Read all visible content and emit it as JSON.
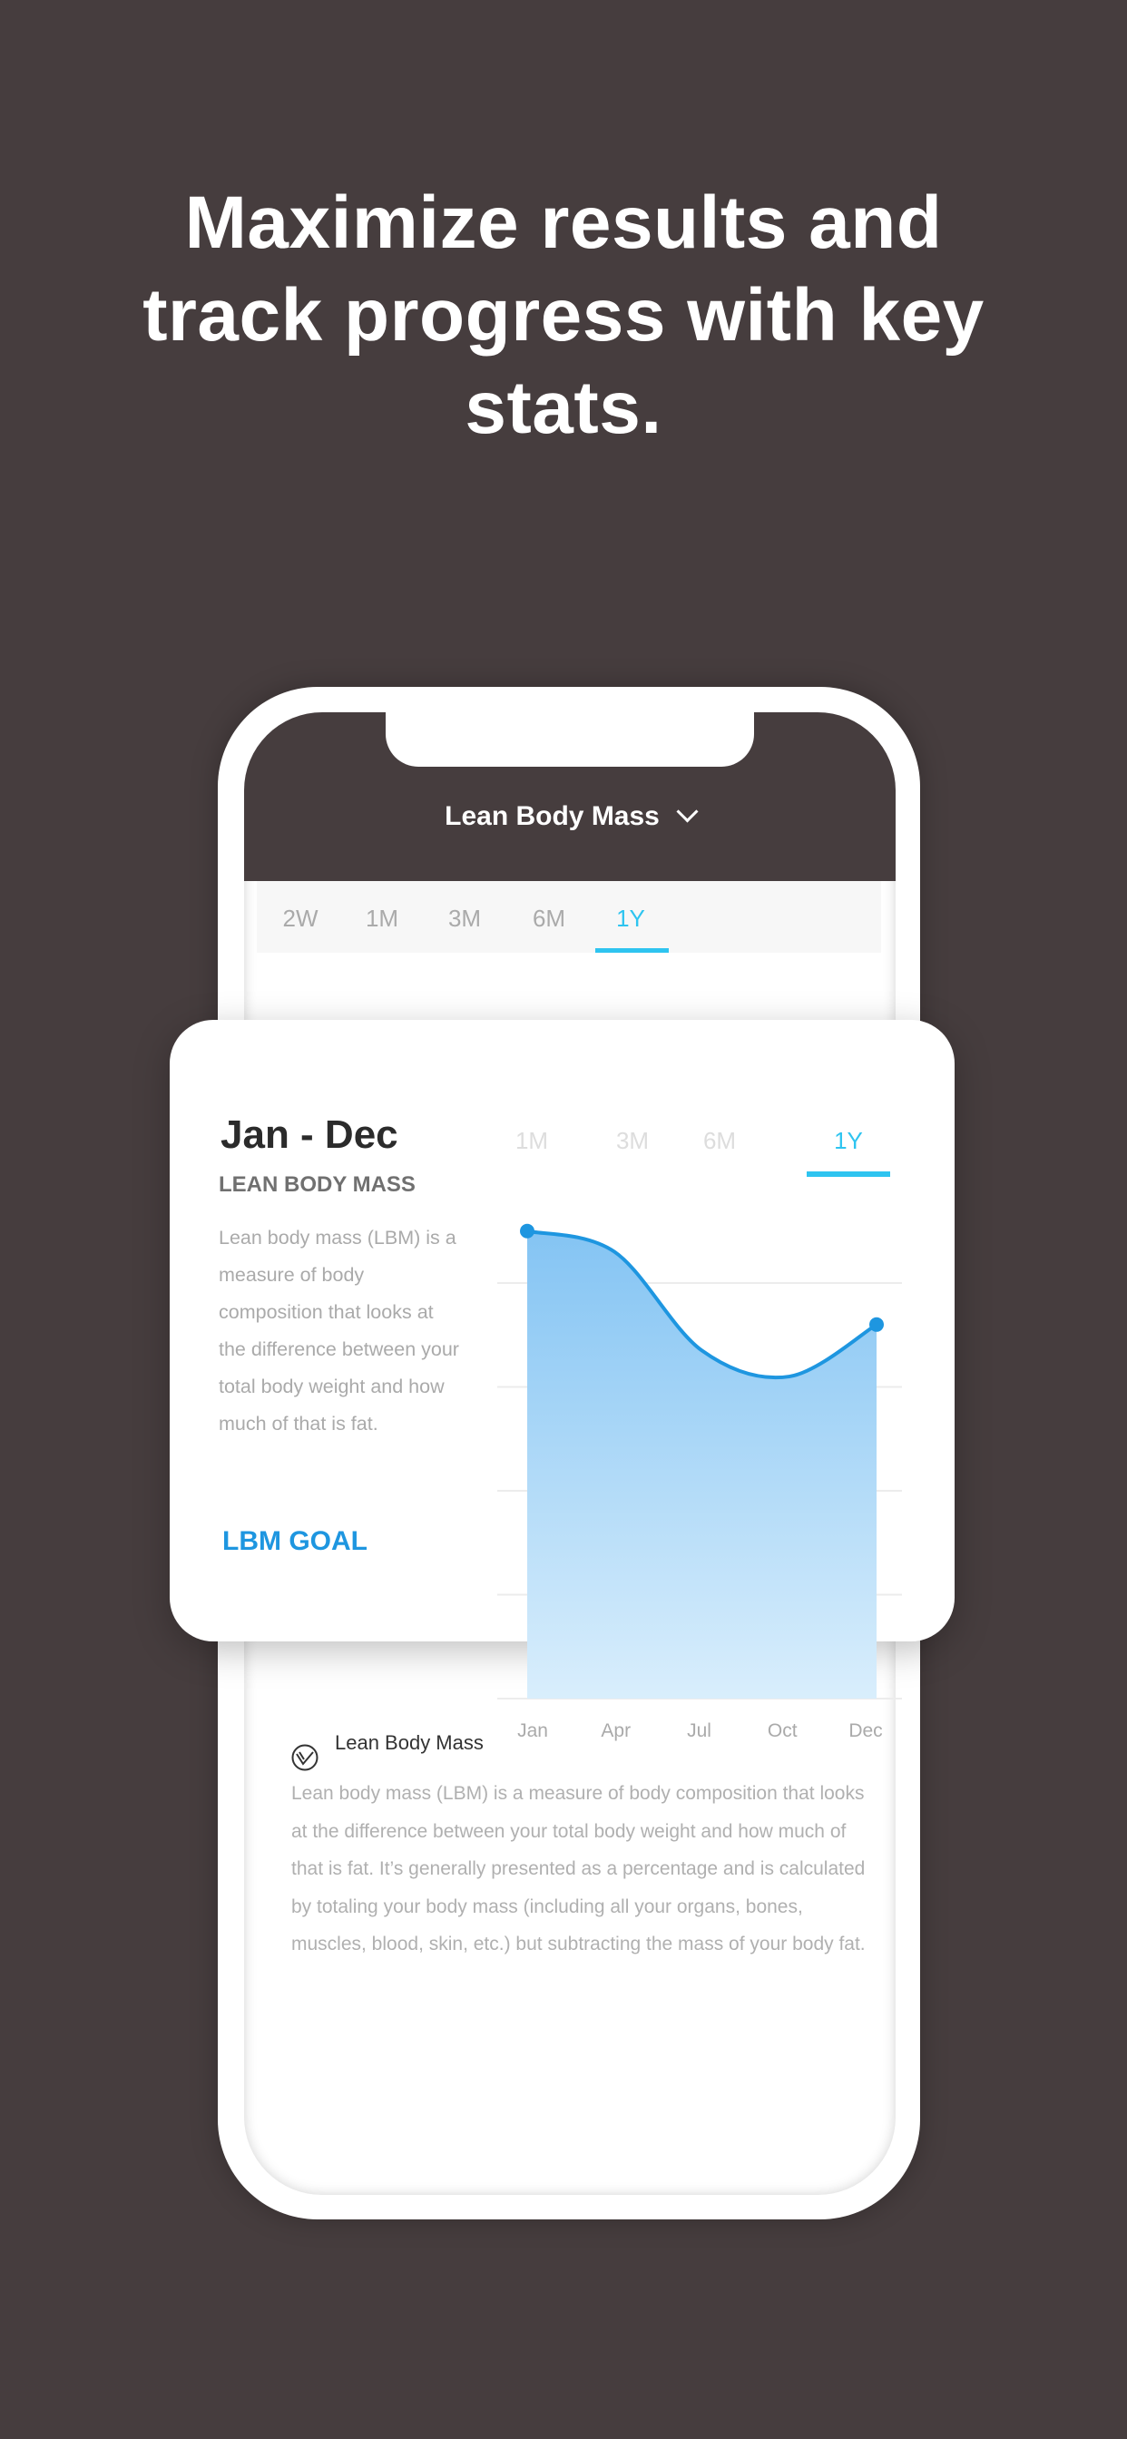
{
  "headline": "Maximize results and track progress with key stats.",
  "header": {
    "title": "Lean Body Mass",
    "dropdown_icon": "chevron-down-icon"
  },
  "tabs": [
    {
      "label": "2W"
    },
    {
      "label": "1M"
    },
    {
      "label": "3M"
    },
    {
      "label": "6M"
    },
    {
      "label": "1Y",
      "active": true
    }
  ],
  "card": {
    "title": "Jan - Dec",
    "tabs": [
      {
        "label": "1M"
      },
      {
        "label": "3M"
      },
      {
        "label": "6M"
      },
      {
        "label": "1Y",
        "active": true
      }
    ],
    "subtitle": "LEAN BODY MASS",
    "description": "Lean body mass (LBM) is a measure of body composition that looks at the difference between your total body weight and how much of that is fat.",
    "goal_label": "LBM GOAL"
  },
  "chart_data": {
    "type": "area",
    "categories": [
      "Jan",
      "Apr",
      "Jul",
      "Oct",
      "Dec"
    ],
    "values": [
      4.5,
      4.3,
      3.35,
      3.1,
      3.6
    ],
    "ylim": [
      0,
      4
    ],
    "grid": true,
    "line_color": "#1e96e0",
    "fill_color": "#8ecbf5",
    "markers": "endpoints"
  },
  "info": {
    "icon": "lean-body-mass-icon",
    "title": "Lean Body Mass",
    "body": "Lean body mass (LBM) is a measure of body composition that looks at the difference between your total body weight and how much of that is fat. It’s generally presented as a percentage and is calculated by totaling your body mass (including all your organs, bones, muscles, blood, skin, etc.) but subtracting the mass of your body fat."
  },
  "colors": {
    "background": "#463d3e",
    "accent": "#2ec4f0",
    "goal": "#1e96e0"
  }
}
